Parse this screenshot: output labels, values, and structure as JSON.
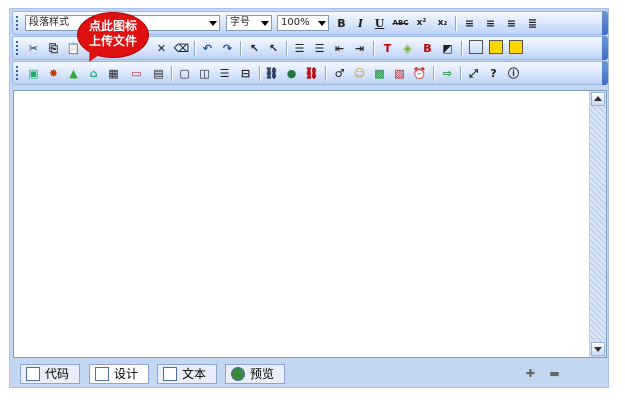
{
  "toolbar": {
    "paragraph_style": "段落样式",
    "font_size": "字号",
    "zoom": "100%"
  },
  "callout": {
    "line1": "点此图标",
    "line2": "上传文件"
  },
  "tabs": [
    {
      "label": "代码"
    },
    {
      "label": "设计"
    },
    {
      "label": "文本"
    },
    {
      "label": "预览"
    }
  ],
  "icons": {
    "bold": "B",
    "italic": "I",
    "underline": "U",
    "strike": "ABC",
    "sup": "x²",
    "sub": "x₂"
  }
}
